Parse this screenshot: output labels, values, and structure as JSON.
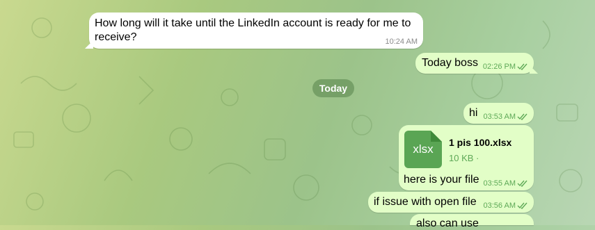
{
  "chat": {
    "date_separator": "Today",
    "messages": [
      {
        "direction": "incoming",
        "line1": "How long will it take until the LinkedIn account is ready for me to",
        "line2": "receive?",
        "time": "10:24 AM"
      },
      {
        "direction": "outgoing",
        "text": "Today boss",
        "time": "02:26 PM",
        "status": "read"
      },
      {
        "direction": "outgoing",
        "text": "hi",
        "time": "03:53 AM",
        "status": "read"
      },
      {
        "direction": "outgoing",
        "type": "file",
        "file_ext": "xlsx",
        "file_name": "1 pis 100.xlsx",
        "file_size": "10 KB ·",
        "caption": "here is your file",
        "time": "03:55 AM",
        "status": "read"
      },
      {
        "direction": "outgoing",
        "text": "if issue with open file",
        "time": "03:56 AM",
        "status": "read"
      },
      {
        "direction": "outgoing",
        "text": "also can use",
        "time": "",
        "status": "read"
      }
    ]
  },
  "colors": {
    "incoming_bubble": "#ffffff",
    "outgoing_bubble": "#e2fec7",
    "outgoing_meta": "#5ea957",
    "file_icon": "#5aa554"
  },
  "icons": {
    "read_status": "double-check-icon"
  }
}
